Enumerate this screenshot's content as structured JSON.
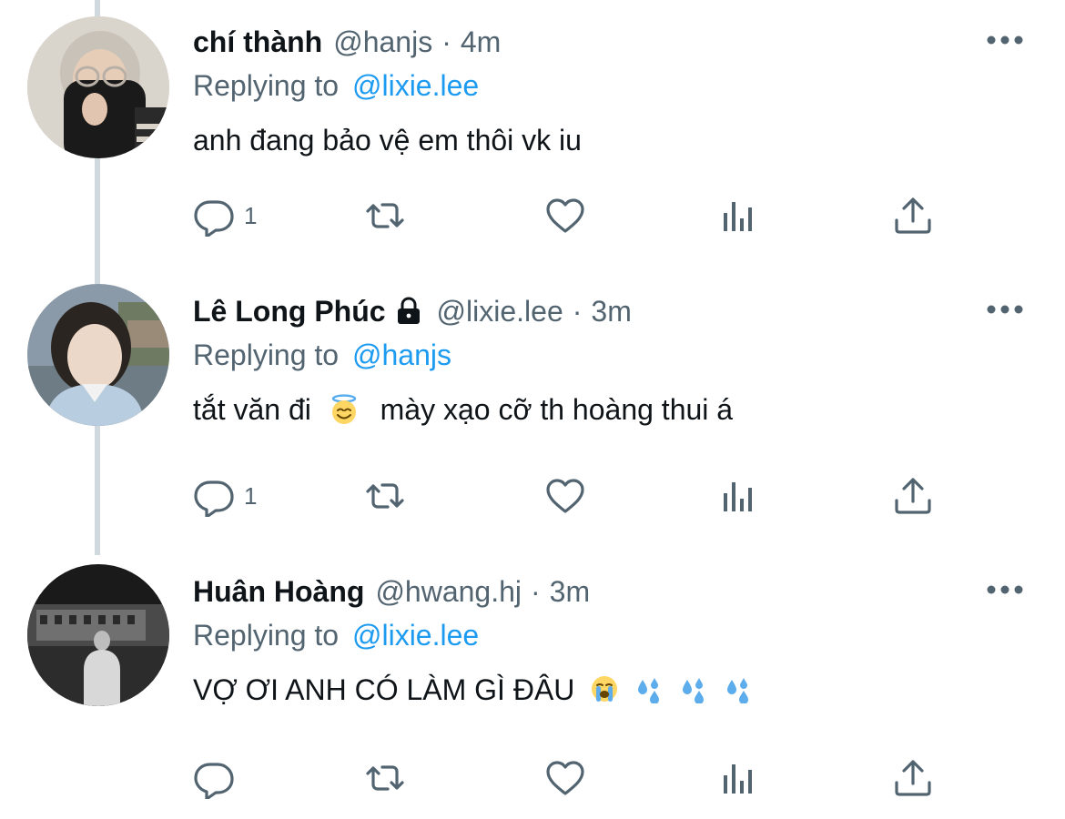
{
  "tweets": [
    {
      "name": "chí thành",
      "handle": "@hanjs",
      "separator": "·",
      "time": "4m",
      "replying_label": "Replying to",
      "replying_to": "@lixie.lee",
      "text": "anh đang bảo vệ em thôi vk iu",
      "reply_count": "1",
      "protected": false
    },
    {
      "name": "Lê Long Phúc",
      "handle": "@lixie.lee",
      "separator": "·",
      "time": "3m",
      "replying_label": "Replying to",
      "replying_to": "@hanjs",
      "text_before_emoji": "tắt văn đi",
      "emoji": "smiling-face-with-halo",
      "text_after_emoji": "mày xạo cỡ th hoàng thui á",
      "reply_count": "1",
      "protected": true
    },
    {
      "name": "Huân Hoàng",
      "handle": "@hwang.hj",
      "separator": "·",
      "time": "3m",
      "replying_label": "Replying to",
      "replying_to": "@lixie.lee",
      "text": "VỢ ƠI ANH CÓ LÀM GÌ ĐÂU",
      "emojis": [
        "loudly-crying-face",
        "sweat-droplets",
        "sweat-droplets",
        "sweat-droplets"
      ],
      "reply_count": "",
      "protected": false
    }
  ],
  "icons": {
    "more": "more-horizontal-icon",
    "reply": "reply-bubble-icon",
    "retweet": "retweet-icon",
    "like": "heart-icon",
    "views": "analytics-bars-icon",
    "share": "share-upload-icon",
    "lock": "lock-icon"
  },
  "colors": {
    "text": "#0f1419",
    "secondary": "#536471",
    "accent": "#1d9bf0",
    "thread_line": "#cfd9de"
  }
}
